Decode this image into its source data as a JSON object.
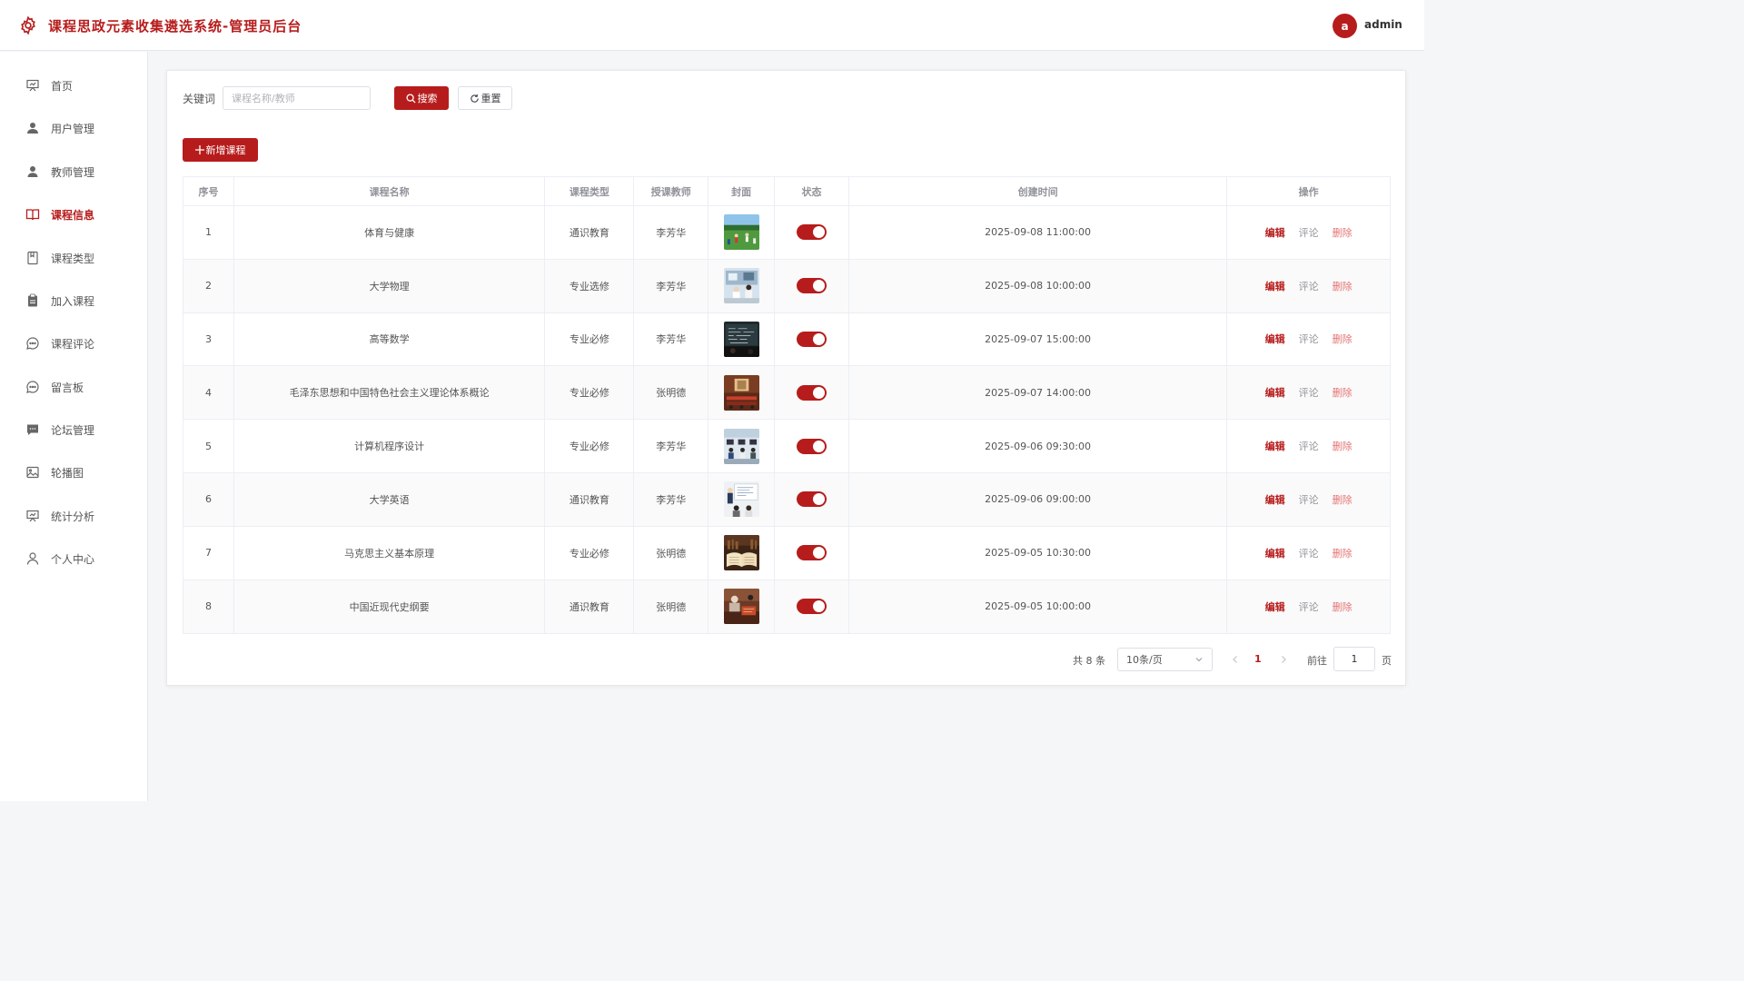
{
  "header": {
    "title": "课程思政元素收集遴选系统-管理员后台",
    "avatar_letter": "a",
    "username": "admin",
    "accent_color": "#b71c1c"
  },
  "sidebar": {
    "items": [
      {
        "label": "首页",
        "icon": "presentation-icon",
        "active": false
      },
      {
        "label": "用户管理",
        "icon": "user-icon",
        "active": false
      },
      {
        "label": "教师管理",
        "icon": "teacher-icon",
        "active": false
      },
      {
        "label": "课程信息",
        "icon": "book-icon",
        "active": true
      },
      {
        "label": "课程类型",
        "icon": "notebook-icon",
        "active": false
      },
      {
        "label": "加入课程",
        "icon": "clipboard-icon",
        "active": false
      },
      {
        "label": "课程评论",
        "icon": "chat-icon",
        "active": false
      },
      {
        "label": "留言板",
        "icon": "message-icon",
        "active": false
      },
      {
        "label": "论坛管理",
        "icon": "forum-icon",
        "active": false
      },
      {
        "label": "轮播图",
        "icon": "picture-icon",
        "active": false
      },
      {
        "label": "统计分析",
        "icon": "chart-icon",
        "active": false
      },
      {
        "label": "个人中心",
        "icon": "person-icon",
        "active": false
      }
    ]
  },
  "search": {
    "label": "关键词",
    "placeholder": "课程名称/教师",
    "value": "",
    "search_label": "搜索",
    "reset_label": "重置"
  },
  "toolbar": {
    "add_label": "新增课程"
  },
  "table": {
    "columns": [
      "序号",
      "课程名称",
      "课程类型",
      "授课教师",
      "封面",
      "状态",
      "创建时间",
      "操作"
    ],
    "rows": [
      {
        "no": "1",
        "name": "体育与健康",
        "type": "通识教育",
        "teacher": "李芳华",
        "cover": "sports-field",
        "status": true,
        "created": "2025-09-08 11:00:00"
      },
      {
        "no": "2",
        "name": "大学物理",
        "type": "专业选修",
        "teacher": "李芳华",
        "cover": "physics-lab",
        "status": true,
        "created": "2025-09-08 10:00:00"
      },
      {
        "no": "3",
        "name": "高等数学",
        "type": "专业必修",
        "teacher": "李芳华",
        "cover": "math-blackboard",
        "status": true,
        "created": "2025-09-07 15:00:00"
      },
      {
        "no": "4",
        "name": "毛泽东思想和中国特色社会主义理论体系概论",
        "type": "专业必修",
        "teacher": "张明德",
        "cover": "hall-portrait",
        "status": true,
        "created": "2025-09-07 14:00:00"
      },
      {
        "no": "5",
        "name": "计算机程序设计",
        "type": "专业必修",
        "teacher": "李芳华",
        "cover": "computer-lab",
        "status": true,
        "created": "2025-09-06 09:30:00"
      },
      {
        "no": "6",
        "name": "大学英语",
        "type": "通识教育",
        "teacher": "李芳华",
        "cover": "english-class",
        "status": true,
        "created": "2025-09-06 09:00:00"
      },
      {
        "no": "7",
        "name": "马克思主义基本原理",
        "type": "专业必修",
        "teacher": "张明德",
        "cover": "open-book",
        "status": true,
        "created": "2025-09-05 10:30:00"
      },
      {
        "no": "8",
        "name": "中国近现代史纲要",
        "type": "通识教育",
        "teacher": "张明德",
        "cover": "history-study",
        "status": true,
        "created": "2025-09-05 10:00:00"
      }
    ],
    "actions": {
      "edit": "编辑",
      "comment": "评论",
      "delete": "删除"
    }
  },
  "pagination": {
    "total_label": "共 8 条",
    "page_size": "10条/页",
    "current_page": "1",
    "goto_label": "前往",
    "goto_value": "1",
    "page_suffix": "页"
  }
}
